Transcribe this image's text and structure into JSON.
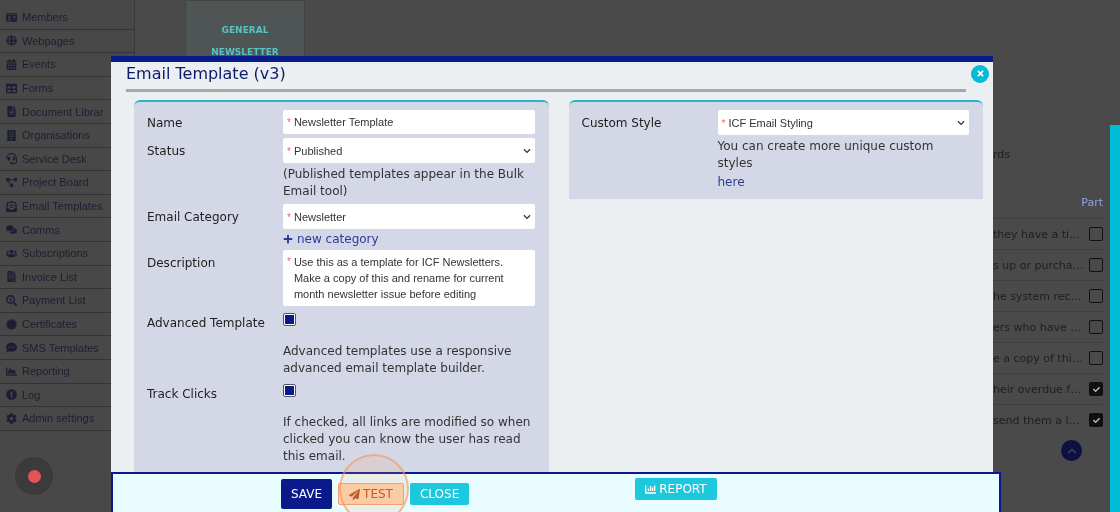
{
  "sidebar": {
    "items": [
      "Members",
      "Webpages",
      "Events",
      "Forms",
      "Document Librar",
      "Organisations",
      "Service Desk",
      "Project Board",
      "Email Templates",
      "Comms",
      "Subscriptions",
      "Invoice List",
      "Payment List",
      "Certificates",
      "SMS Templates",
      "Reporting",
      "Log",
      "Admin settings"
    ]
  },
  "category_list": {
    "items": [
      "GENERAL",
      "NEWSLETTER"
    ]
  },
  "records": {
    "text": "rds",
    "column_header": "Part",
    "rows": [
      {
        "text": "they have a ti…",
        "checked": false
      },
      {
        "text": "s up or purcha…",
        "checked": false
      },
      {
        "text": "he system rec…",
        "checked": false
      },
      {
        "text": "ers who have …",
        "checked": false
      },
      {
        "text": "e a copy of thi…",
        "checked": false
      },
      {
        "text": "heir overdue f…",
        "checked": true
      },
      {
        "text": "send them a l…",
        "checked": true
      }
    ]
  },
  "dialog": {
    "title": "Email Template (v3)",
    "left_fields": [
      {
        "kind": "text",
        "label": "Name",
        "value": "Newsletter Template",
        "marker": "*"
      },
      {
        "kind": "select",
        "label": "Status",
        "value": "Published",
        "marker": "*",
        "help": "(Published templates appear in the Bulk Email tool)"
      },
      {
        "kind": "select",
        "label": "Email Category",
        "value": "Newsletter",
        "marker": "*",
        "link": "new category"
      },
      {
        "kind": "textarea",
        "label": "Description",
        "value": "Use this as a template for ICF Newsletters. Make a copy of this and rename for current month newsletter issue before editing",
        "marker": "*"
      },
      {
        "kind": "checkbox",
        "label": "Advanced Template",
        "checked": true,
        "help": "Advanced templates use a responsive advanced email template builder."
      },
      {
        "kind": "checkbox",
        "label": "Track Clicks",
        "checked": true,
        "help": "If checked, all links are modified so when clicked you can know the user has read this email."
      }
    ],
    "right_fields": [
      {
        "kind": "select",
        "label": "Custom Style",
        "value": "ICF Email Styling",
        "marker": "*",
        "help": "You can create more unique custom styles",
        "link": "here"
      }
    ],
    "buttons": [
      {
        "kind": "primary",
        "label": "SAVE"
      },
      {
        "kind": "outline",
        "label": "TEST",
        "highlighted": true
      },
      {
        "kind": "info",
        "label": "CLOSE"
      },
      {
        "kind": "report",
        "label": "REPORT"
      }
    ]
  }
}
